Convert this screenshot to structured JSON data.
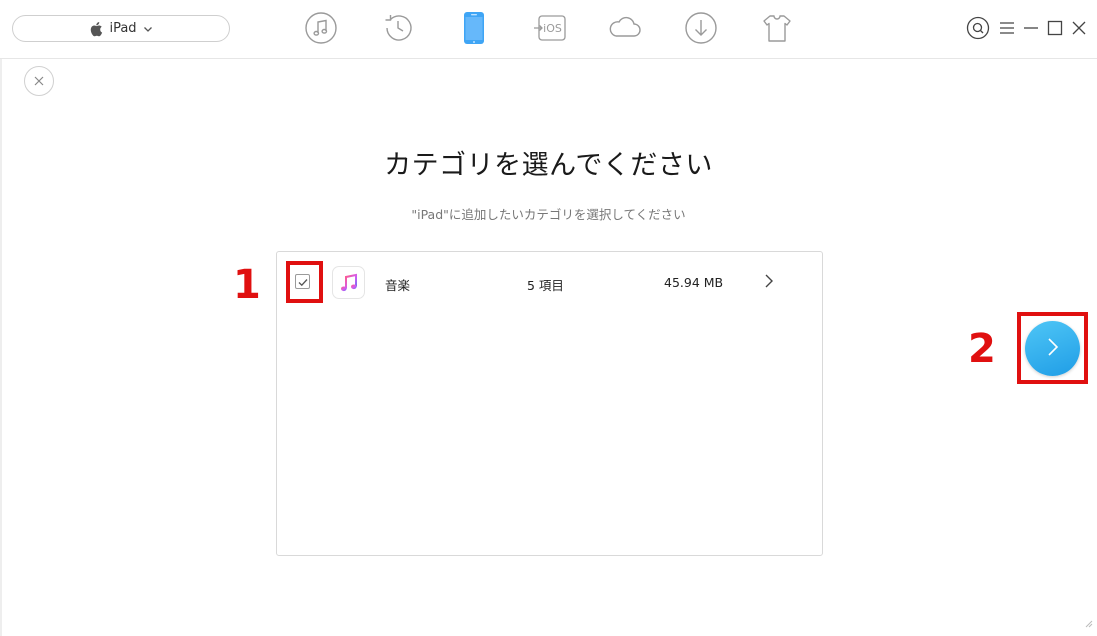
{
  "header": {
    "device_name": "iPad"
  },
  "page": {
    "title": "カテゴリを選んでください",
    "subtitle": "\"iPad\"に追加したいカテゴリを選択してください"
  },
  "category_list": {
    "items": [
      {
        "name": "音楽",
        "count": "5 項目",
        "size": "45.94 MB",
        "checked": true
      }
    ]
  },
  "annotations": {
    "step1": "1",
    "step2": "2",
    "highlight_color": "#e01010"
  },
  "colors": {
    "accent": "#2aa8ee",
    "active_nav": "#3fa5f5"
  }
}
